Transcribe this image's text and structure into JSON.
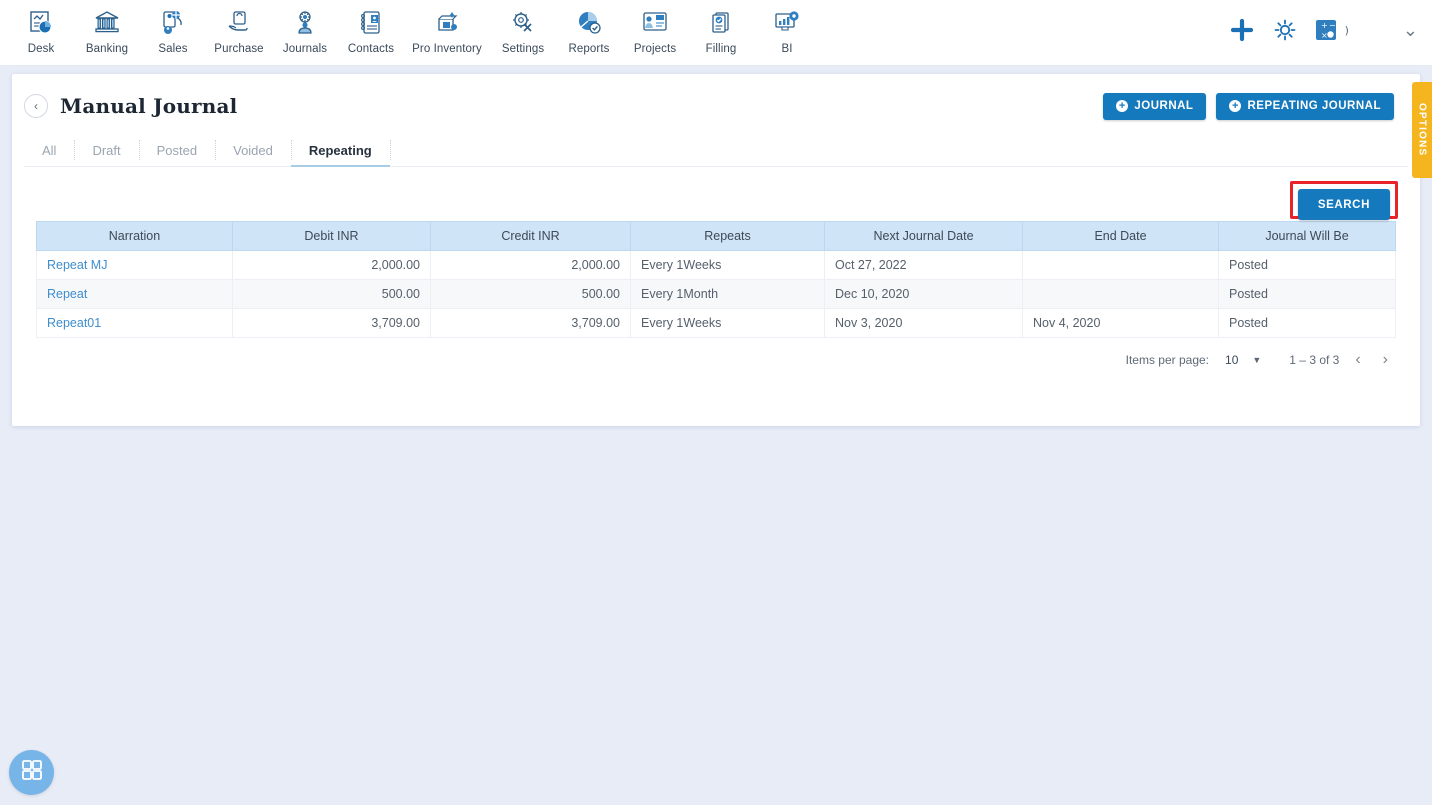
{
  "topnav": {
    "items": [
      {
        "label": "Desk",
        "icon": "dashboard-icon"
      },
      {
        "label": "Banking",
        "icon": "bank-icon"
      },
      {
        "label": "Sales",
        "icon": "sales-icon"
      },
      {
        "label": "Purchase",
        "icon": "purchase-icon"
      },
      {
        "label": "Journals",
        "icon": "journals-icon"
      },
      {
        "label": "Contacts",
        "icon": "contacts-icon"
      },
      {
        "label": "Pro Inventory",
        "icon": "inventory-icon"
      },
      {
        "label": "Settings",
        "icon": "settings-tools-icon"
      },
      {
        "label": "Reports",
        "icon": "reports-icon"
      },
      {
        "label": "Projects",
        "icon": "projects-icon"
      },
      {
        "label": "Filling",
        "icon": "filling-icon"
      },
      {
        "label": "BI",
        "icon": "bi-icon"
      }
    ],
    "actions": {
      "add": "add-icon",
      "settings": "gear-icon",
      "calculator": "calculator-icon",
      "tiny_glyph": ")",
      "chevron": "chevron-down-icon"
    }
  },
  "page": {
    "title": "Manual Journal",
    "back_icon": "chevron-left-icon",
    "buttons": [
      {
        "label": "JOURNAL",
        "icon": "plus-circle-icon"
      },
      {
        "label": "REPEATING JOURNAL",
        "icon": "plus-circle-icon"
      }
    ],
    "options_tab": "OPTIONS",
    "search_label": "SEARCH",
    "highlight_color": "#e8242a",
    "accent_color": "#1479bd"
  },
  "tabs": [
    {
      "label": "All",
      "active": false
    },
    {
      "label": "Draft",
      "active": false
    },
    {
      "label": "Posted",
      "active": false
    },
    {
      "label": "Voided",
      "active": false
    },
    {
      "label": "Repeating",
      "active": true
    }
  ],
  "table": {
    "columns": [
      "Narration",
      "Debit INR",
      "Credit INR",
      "Repeats",
      "Next Journal Date",
      "End Date",
      "Journal Will Be"
    ],
    "rows": [
      {
        "narration": "Repeat MJ",
        "debit": "2,000.00",
        "credit": "2,000.00",
        "repeats": "Every 1Weeks",
        "next_journal_date": "Oct 27, 2022",
        "end_date": "",
        "journal_will_be": "Posted"
      },
      {
        "narration": "Repeat",
        "debit": "500.00",
        "credit": "500.00",
        "repeats": "Every 1Month",
        "next_journal_date": "Dec 10, 2020",
        "end_date": "",
        "journal_will_be": "Posted"
      },
      {
        "narration": "Repeat01",
        "debit": "3,709.00",
        "credit": "3,709.00",
        "repeats": "Every 1Weeks",
        "next_journal_date": "Nov 3, 2020",
        "end_date": "Nov 4, 2020",
        "journal_will_be": "Posted"
      }
    ]
  },
  "pagination": {
    "items_per_page_label": "Items per page:",
    "items_per_page_value": "10",
    "range": "1 – 3 of 3",
    "prev_icon": "chevron-left-icon",
    "next_icon": "chevron-right-icon"
  },
  "fab": {
    "icon": "grid-apps-icon"
  }
}
